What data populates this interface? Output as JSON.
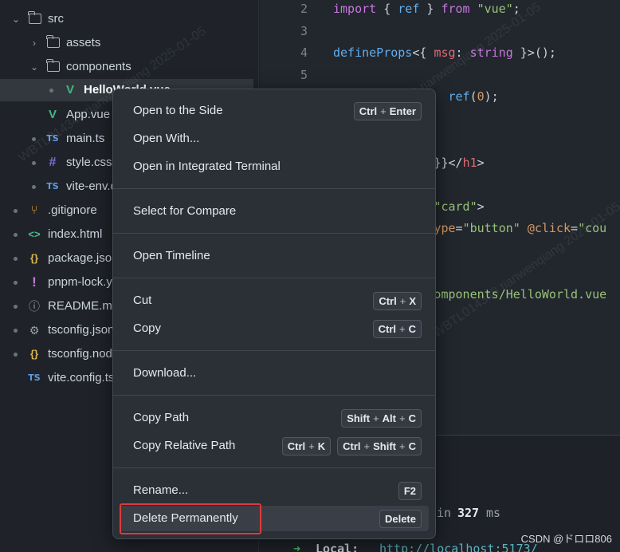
{
  "explorer": {
    "rows": [
      {
        "label": "src"
      },
      {
        "label": "assets"
      },
      {
        "label": "components"
      },
      {
        "label": "HelloWorld.vue"
      },
      {
        "label": "App.vue"
      },
      {
        "label": "main.ts"
      },
      {
        "label": "style.css"
      },
      {
        "label": "vite-env.d.ts"
      },
      {
        "label": ".gitignore"
      },
      {
        "label": "index.html"
      },
      {
        "label": "package.json"
      },
      {
        "label": "pnpm-lock.yaml"
      },
      {
        "label": "README.md"
      },
      {
        "label": "tsconfig.json"
      },
      {
        "label": "tsconfig.node.json"
      },
      {
        "label": "vite.config.ts"
      }
    ],
    "icons": {
      "ts": "TS",
      "vue": "V",
      "css": "#",
      "git": "⑂",
      "html": "<>",
      "json": "{}",
      "yaml": "!",
      "info": "ⓘ",
      "gear": "⚙"
    }
  },
  "editor": {
    "lines": [
      {
        "n": "2",
        "segments": [
          {
            "t": "import",
            "c": "kw"
          },
          {
            "t": " { "
          },
          {
            "t": "ref",
            "c": "fn"
          },
          {
            "t": " } "
          },
          {
            "t": "from",
            "c": "kw"
          },
          {
            "t": " "
          },
          {
            "t": "\"vue\"",
            "c": "str"
          },
          {
            "t": ";"
          }
        ]
      },
      {
        "n": "3",
        "segments": []
      },
      {
        "n": "4",
        "segments": [
          {
            "t": "defineProps",
            "c": "fn"
          },
          {
            "t": "<{ "
          },
          {
            "t": "msg",
            "c": "tag"
          },
          {
            "t": ": "
          },
          {
            "t": "string",
            "c": "kw"
          },
          {
            "t": " }>();"
          }
        ]
      },
      {
        "n": "5",
        "segments": []
      },
      {
        "n": "",
        "segments": [
          {
            "t": "                ref",
            "c": "fn"
          },
          {
            "t": "("
          },
          {
            "t": "0",
            "c": "num"
          },
          {
            "t": ");"
          }
        ]
      },
      {
        "n": "",
        "segments": []
      },
      {
        "n": "",
        "segments": []
      },
      {
        "n": "",
        "segments": [
          {
            "t": "              }}</"
          },
          {
            "t": "h1",
            "c": "tag"
          },
          {
            "t": ">"
          }
        ]
      },
      {
        "n": "",
        "segments": []
      },
      {
        "n": "",
        "segments": [
          {
            "t": "              "
          },
          {
            "t": "\"card\"",
            "c": "str"
          },
          {
            "t": ">"
          }
        ]
      },
      {
        "n": "",
        "segments": [
          {
            "t": "              "
          },
          {
            "t": "ype",
            "c": "attr"
          },
          {
            "t": "="
          },
          {
            "t": "\"button\"",
            "c": "str"
          },
          {
            "t": " "
          },
          {
            "t": "@click",
            "c": "attr"
          },
          {
            "t": "="
          },
          {
            "t": "\"cou",
            "c": "str"
          }
        ]
      },
      {
        "n": "",
        "segments": []
      },
      {
        "n": "",
        "segments": []
      },
      {
        "n": "",
        "segments": [
          {
            "t": "              omponents/HelloWorld.vue",
            "c": "str"
          }
        ]
      }
    ]
  },
  "terminal": {
    "ready_in": "in",
    "ready_ms": "327",
    "ready_unit": "ms",
    "local_arrow": "➜",
    "local_label": "Local:",
    "local_url": "http://localhost:5173/"
  },
  "context_menu": {
    "items": [
      {
        "label": "Open to the Side",
        "keys": [
          [
            "Ctrl",
            "Enter"
          ]
        ]
      },
      {
        "label": "Open With...",
        "keys": []
      },
      {
        "label": "Open in Integrated Terminal",
        "keys": []
      },
      {
        "label": "Select for Compare",
        "keys": []
      },
      {
        "label": "Open Timeline",
        "keys": []
      },
      {
        "label": "Cut",
        "keys": [
          [
            "Ctrl",
            "X"
          ]
        ]
      },
      {
        "label": "Copy",
        "keys": [
          [
            "Ctrl",
            "C"
          ]
        ]
      },
      {
        "label": "Download...",
        "keys": []
      },
      {
        "label": "Copy Path",
        "keys": [
          [
            "Shift",
            "Alt",
            "C"
          ]
        ]
      },
      {
        "label": "Copy Relative Path",
        "keys": [
          [
            "Ctrl",
            "K"
          ],
          [
            "Ctrl",
            "Shift",
            "C"
          ]
        ]
      },
      {
        "label": "Rename...",
        "keys": [
          [
            "F2"
          ]
        ]
      },
      {
        "label": "Delete Permanently",
        "keys": [
          [
            "Delete"
          ]
        ]
      }
    ]
  },
  "watermark": {
    "text": "WBTL014348  tianwenqiang  2025-01-05"
  },
  "footer": {
    "credit": "CSDN @ドロロ806"
  },
  "colors": {
    "highlight": "#e03a3a",
    "menu_bg": "#2b2f36",
    "accent_vue": "#42b883",
    "accent_ts": "#5e9be6"
  }
}
